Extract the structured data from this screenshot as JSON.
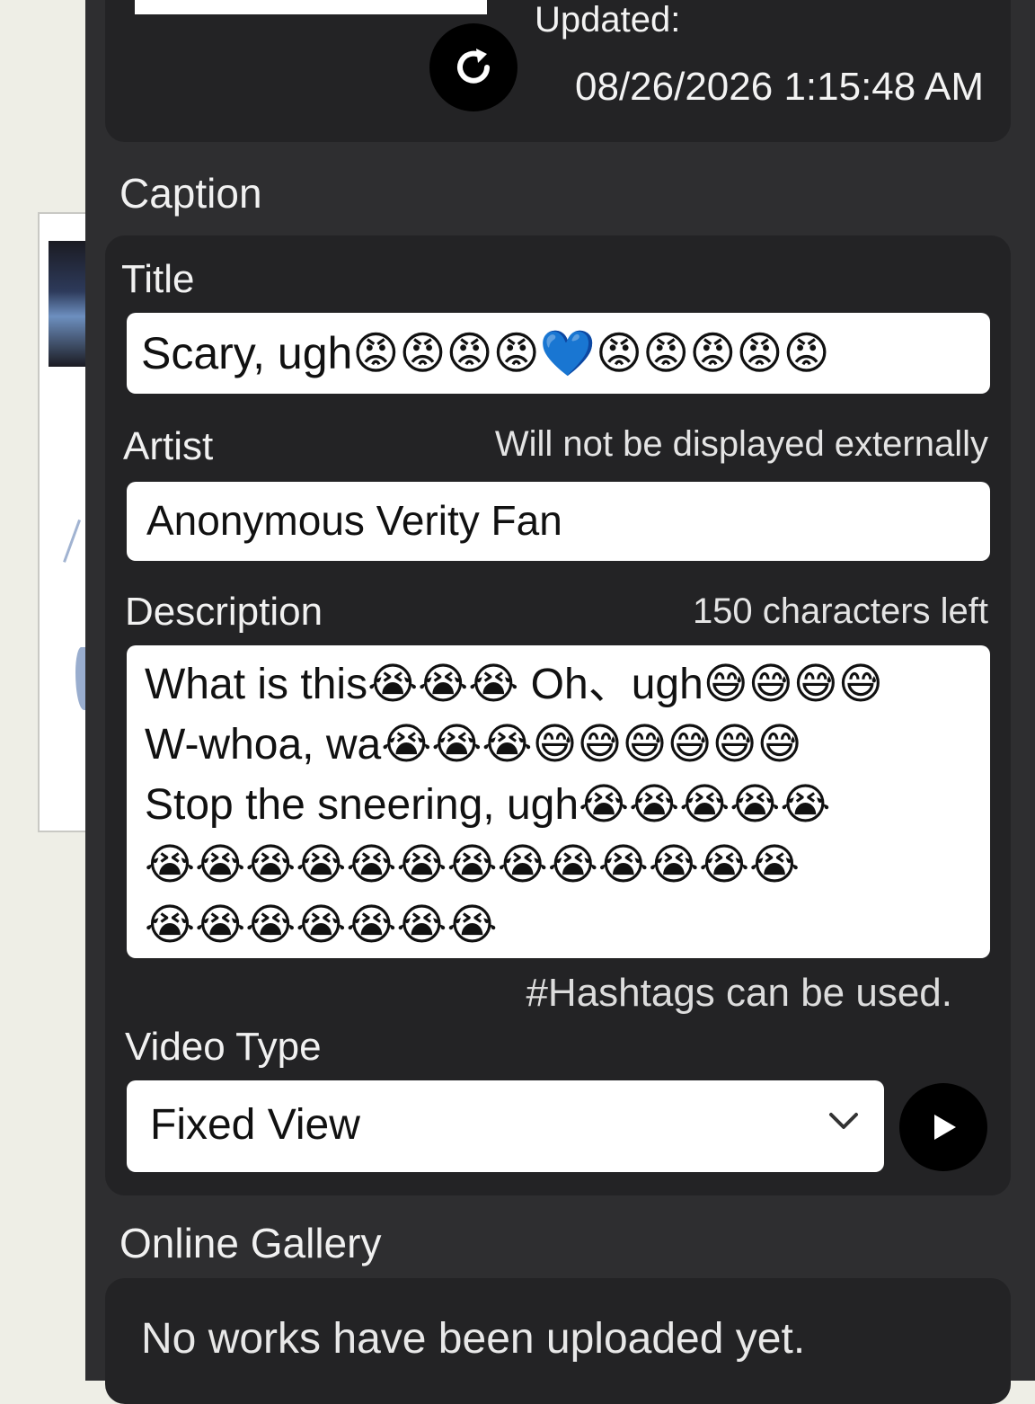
{
  "header": {
    "updated_label": "Updated:",
    "updated_value": "08/26/2026 1:15:48 AM"
  },
  "caption": {
    "section_title": "Caption",
    "title_label": "Title",
    "title_value": "Scary, ugh😡😡😡😡💙😡😡😡😡😡",
    "artist_label": "Artist",
    "artist_hint": "Will not be displayed externally",
    "artist_value": "Anonymous Verity Fan",
    "description_label": "Description",
    "description_hint": "150 characters left",
    "description_value": "What is this😭😭😭 Oh、ugh😅😅😅😅\nW-whoa, wa😭😭😭😅😅😅😅😅😅\nStop the sneering, ugh😭😭😭😭😭\n😭😭😭😭😭😭😭😭😭😭😭😭😭\n😭😭😭😭😭😭😭",
    "hashtag_note": "#Hashtags can be used.",
    "video_type_label": "Video Type",
    "video_type_value": "Fixed View"
  },
  "gallery": {
    "section_title": "Online Gallery",
    "empty_message": "No works have been uploaded yet."
  },
  "icons": {
    "refresh": "refresh-icon",
    "chevron": "chevron-down-icon",
    "play": "play-icon"
  }
}
